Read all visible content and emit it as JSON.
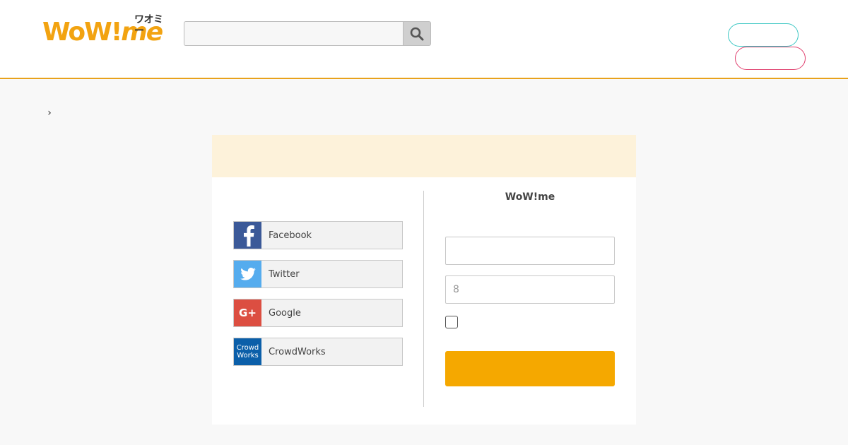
{
  "header": {
    "logo_text": "WoW!",
    "logo_me": "me",
    "logo_kana": "ワオミー",
    "brand_color": "#f2a311",
    "search": {
      "value": "",
      "placeholder": "",
      "icon": "search-icon"
    },
    "register_label": "",
    "login_label": ""
  },
  "breadcrumb": {
    "separator": "›",
    "current": ""
  },
  "card": {
    "heading": "",
    "sns": [
      {
        "label": "Facebook",
        "icon": "facebook-icon",
        "color": "#3b5998"
      },
      {
        "label": "Twitter",
        "icon": "twitter-icon",
        "color": "#55acee"
      },
      {
        "label": "Google",
        "icon": "google-plus-icon",
        "icon_text": "G+",
        "color": "#dc4e41"
      },
      {
        "label": "CrowdWorks",
        "icon": "crowdworks-icon",
        "icon_line1": "Crowd",
        "icon_line2": "Works",
        "color": "#0b5fa9"
      }
    ],
    "form": {
      "title": "WoW!me",
      "email": {
        "value": "",
        "placeholder": ""
      },
      "password": {
        "value": "",
        "placeholder": "8"
      },
      "remember_label": "",
      "submit_label": "",
      "submit_color": "#f5a800"
    }
  }
}
